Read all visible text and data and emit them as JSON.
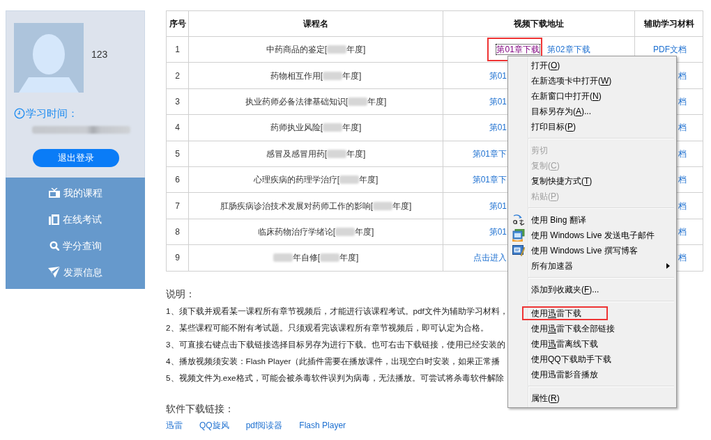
{
  "sidebar": {
    "username": "123",
    "study_time": {
      "label": "学习时间：",
      "value_blurred": true
    },
    "logout_button": "退出登录",
    "nav": [
      "我的课程",
      "在线考试",
      "学分查询",
      "发票信息"
    ]
  },
  "table": {
    "columns": [
      "序号",
      "课程名",
      "视频下载地址",
      "辅助学习材料"
    ],
    "rows": [
      {
        "number": "1",
        "course": [
          {
            "kind": "text",
            "text": "中药商品的鉴定["
          },
          {
            "kind": "blurred"
          },
          {
            "kind": "text",
            "text": "年度]"
          }
        ],
        "covered_by_menu": false,
        "video_links": [
          {
            "label": "第01章下载",
            "visited": true,
            "focused": true,
            "highlighted": true
          },
          {
            "label": "第02章下载",
            "visited": false,
            "focused": false,
            "highlighted": false
          }
        ],
        "material": "PDF文档"
      },
      {
        "number": "2",
        "course": [
          {
            "kind": "text",
            "text": "药物相互作用["
          },
          {
            "kind": "blurred"
          },
          {
            "kind": "text",
            "text": "年度]"
          }
        ],
        "covered_by_menu": true,
        "video_links": [
          {
            "label": "第01",
            "visited": false,
            "focused": false,
            "highlighted": false
          }
        ],
        "material": "档"
      },
      {
        "number": "3",
        "course": [
          {
            "kind": "text",
            "text": "执业药师必备法律基础知识["
          },
          {
            "kind": "blurred"
          },
          {
            "kind": "text",
            "text": "年度]"
          }
        ],
        "covered_by_menu": true,
        "video_links": [
          {
            "label": "第01",
            "visited": false,
            "focused": false,
            "highlighted": false
          }
        ],
        "material": "档"
      },
      {
        "number": "4",
        "course": [
          {
            "kind": "text",
            "text": "药师执业风险["
          },
          {
            "kind": "blurred"
          },
          {
            "kind": "text",
            "text": "年度]"
          }
        ],
        "covered_by_menu": true,
        "video_links": [
          {
            "label": "第01",
            "visited": false,
            "focused": false,
            "highlighted": false
          }
        ],
        "material": "档"
      },
      {
        "number": "5",
        "course": [
          {
            "kind": "text",
            "text": "感冒及感冒用药["
          },
          {
            "kind": "blurred"
          },
          {
            "kind": "text",
            "text": "年度]"
          }
        ],
        "covered_by_menu": true,
        "video_links": [
          {
            "label": "第01章下",
            "visited": false,
            "focused": false,
            "highlighted": false
          }
        ],
        "material": "档"
      },
      {
        "number": "6",
        "course": [
          {
            "kind": "text",
            "text": "心理疾病的药理学治疗["
          },
          {
            "kind": "blurred"
          },
          {
            "kind": "text",
            "text": "年度]"
          }
        ],
        "covered_by_menu": true,
        "video_links": [
          {
            "label": "第01章下",
            "visited": false,
            "focused": false,
            "highlighted": false
          }
        ],
        "material": "档"
      },
      {
        "number": "7",
        "course": [
          {
            "kind": "text",
            "text": "肛肠疾病诊治技术发展对药师工作的影响["
          },
          {
            "kind": "blurred"
          },
          {
            "kind": "text",
            "text": "年度]"
          }
        ],
        "covered_by_menu": true,
        "video_links": [
          {
            "label": "第01",
            "visited": false,
            "focused": false,
            "highlighted": false
          }
        ],
        "material": "档"
      },
      {
        "number": "8",
        "course": [
          {
            "kind": "text",
            "text": "临床药物治疗学绪论["
          },
          {
            "kind": "blurred"
          },
          {
            "kind": "text",
            "text": "年度]"
          }
        ],
        "covered_by_menu": true,
        "video_links": [
          {
            "label": "第01",
            "visited": false,
            "focused": false,
            "highlighted": false
          }
        ],
        "material": "档"
      },
      {
        "number": "9",
        "course": [
          {
            "kind": "blurred"
          },
          {
            "kind": "text",
            "text": "年自修["
          },
          {
            "kind": "blurred"
          },
          {
            "kind": "text",
            "text": "年度]"
          }
        ],
        "covered_by_menu": true,
        "video_links": [
          {
            "label": "点击进入",
            "visited": false,
            "focused": false,
            "highlighted": false
          }
        ],
        "material": "档"
      }
    ]
  },
  "notes": {
    "title": "说明：",
    "lines": [
      "1、须下载并观看某一课程所有章节视频后，才能进行该课程考试。pdf文件为辅助学习材料，",
      "2、某些课程可能不附有考试题。只须观看完该课程所有章节视频后，即可认定为合格。",
      "3、可直接右键点击下载链接选择目标另存为进行下载。也可右击下载链接，使用已经安装的",
      "4、播放视频须安装：Flash Player（此插件需要在播放课件，出现空白时安装，如果正常播",
      "5、视频文件为.exe格式，可能会被杀毒软件误判为病毒，无法播放。可尝试将杀毒软件解除"
    ]
  },
  "downloads": {
    "title": "软件下载链接：",
    "links": [
      "迅雷",
      "QQ旋风",
      "pdf阅读器",
      "Flash Player"
    ]
  },
  "context_menu": {
    "entries": [
      {
        "kind": "item",
        "text": "打开(",
        "key": "O",
        "rest": ")",
        "disabled": false,
        "highlighted": false
      },
      {
        "kind": "item",
        "text": "在新选项卡中打开(",
        "key": "W",
        "rest": ")",
        "disabled": false,
        "highlighted": false
      },
      {
        "kind": "item",
        "text": "在新窗口中打开(",
        "key": "N",
        "rest": ")",
        "disabled": false,
        "highlighted": false
      },
      {
        "kind": "item",
        "text": "目标另存为(",
        "key": "A",
        "rest": ")...",
        "disabled": false,
        "highlighted": false
      },
      {
        "kind": "item",
        "text": "打印目标(",
        "key": "P",
        "rest": ")",
        "disabled": false,
        "highlighted": false
      },
      {
        "kind": "separator"
      },
      {
        "kind": "item",
        "text": "剪切",
        "disabled": true,
        "highlighted": false
      },
      {
        "kind": "item",
        "text": "复制(",
        "key": "C",
        "rest": ")",
        "disabled": true,
        "highlighted": false
      },
      {
        "kind": "item",
        "text": "复制快捷方式(",
        "key": "T",
        "rest": ")",
        "disabled": false,
        "highlighted": false
      },
      {
        "kind": "item",
        "text": "粘贴(",
        "key": "P",
        "rest": ")",
        "disabled": true,
        "highlighted": false
      },
      {
        "kind": "separator"
      },
      {
        "kind": "item",
        "text": "使用 Bing 翻译",
        "disabled": false,
        "highlighted": false
      },
      {
        "kind": "item",
        "text": "使用 Windows Live 发送电子邮件",
        "disabled": false,
        "highlighted": false
      },
      {
        "kind": "item",
        "text": "使用 Windows Live 撰写博客",
        "disabled": false,
        "highlighted": false
      },
      {
        "kind": "submenu",
        "text": "所有加速器",
        "disabled": false,
        "highlighted": false
      },
      {
        "kind": "separator"
      },
      {
        "kind": "item",
        "text": "添加到收藏夹(",
        "key": "F",
        "rest": ")...",
        "disabled": false,
        "highlighted": false
      },
      {
        "kind": "separator"
      },
      {
        "kind": "item",
        "text": "使用",
        "key": "迅",
        "rest": "雷下载",
        "disabled": false,
        "highlighted": true
      },
      {
        "kind": "item",
        "text": "使用",
        "key": "迅",
        "rest": "雷下载全部链接",
        "disabled": false,
        "highlighted": false
      },
      {
        "kind": "item",
        "text": "使用",
        "key": "迅",
        "rest": "雷离线下载",
        "disabled": false,
        "highlighted": false
      },
      {
        "kind": "item",
        "text": "使用QQ下载助手下载",
        "disabled": false,
        "highlighted": false
      },
      {
        "kind": "item",
        "text": "使用迅雷影音播放",
        "disabled": false,
        "highlighted": false
      },
      {
        "kind": "separator"
      },
      {
        "kind": "item",
        "text": "属性(",
        "key": "R",
        "rest": ")",
        "disabled": false,
        "highlighted": false
      }
    ]
  }
}
